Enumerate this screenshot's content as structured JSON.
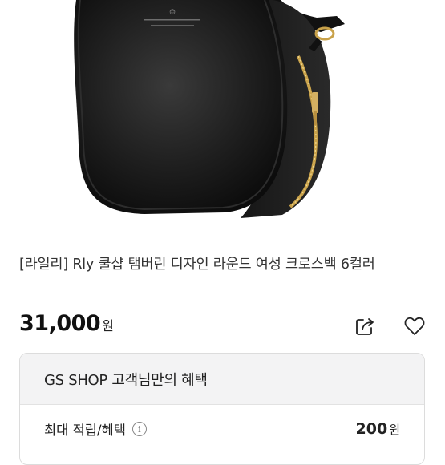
{
  "product": {
    "title": "[라일리] Rly 쿨샵 탬버린 디자인 라운드 여성 크로스백 6컬러",
    "price": "31,000",
    "price_unit": "원",
    "image_icon": "black-round-crossbody-bag-photo"
  },
  "actions": {
    "share_icon": "share-icon",
    "wishlist_icon": "heart-icon"
  },
  "benefits": {
    "header": "GS SHOP 고객님만의 혜택",
    "row_label": "최대 적립/혜택",
    "info_icon_glyph": "i",
    "row_value": "200",
    "row_unit": "원"
  },
  "colors": {
    "bag_body": "#1a1a1a",
    "zipper_gold": "#c9a24a",
    "benefit_header_bg": "#f3f3f4"
  }
}
